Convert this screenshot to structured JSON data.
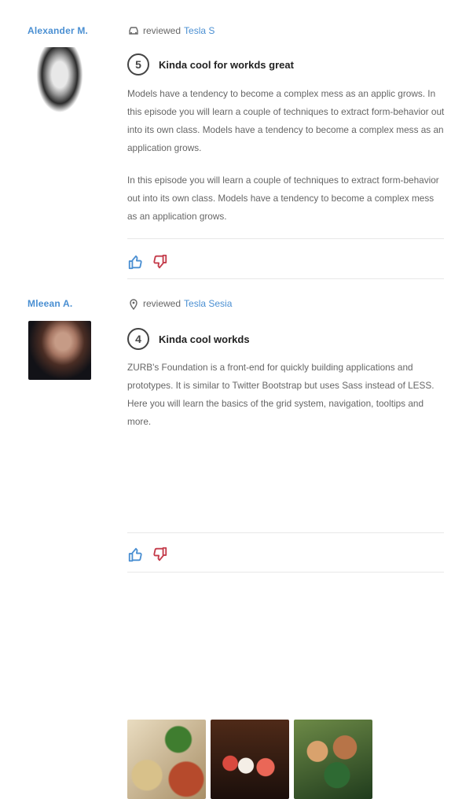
{
  "reviews": [
    {
      "author": "Alexander M.",
      "verb": "reviewed",
      "product": "Tesla S",
      "rating": "5",
      "title": "Kinda cool for workds great",
      "body": [
        "Models have a tendency to become a complex mess as an applic grows. In this episode you will learn a couple of techniques to extract form-behavior out into its own class. Models have a tendency to become a complex mess as an application grows.",
        "In this episode you will learn a couple of techniques to extract form-behavior out into its own class. Models have a tendency to become a complex mess as an application grows."
      ]
    },
    {
      "author": "Mleean A.",
      "verb": "reviewed",
      "product": "Tesla Sesia",
      "rating": "4",
      "title": "Kinda cool workds",
      "body": [
        "ZURB's Foundation is a front-end for quickly building applications and prototypes. It is similar to Twitter Bootstrap but uses Sass instead of LESS. Here you will learn the basics of the grid system, navigation, tooltips and more."
      ]
    }
  ],
  "icons": {
    "review1_meta": "car-icon",
    "review2_meta": "map-pin-icon",
    "upvote": "thumbs-up-icon",
    "downvote": "thumbs-down-icon"
  },
  "colors": {
    "link": "#4a8fd2",
    "thumbs_up": "#4a8fd2",
    "thumbs_down": "#c43b4a"
  }
}
